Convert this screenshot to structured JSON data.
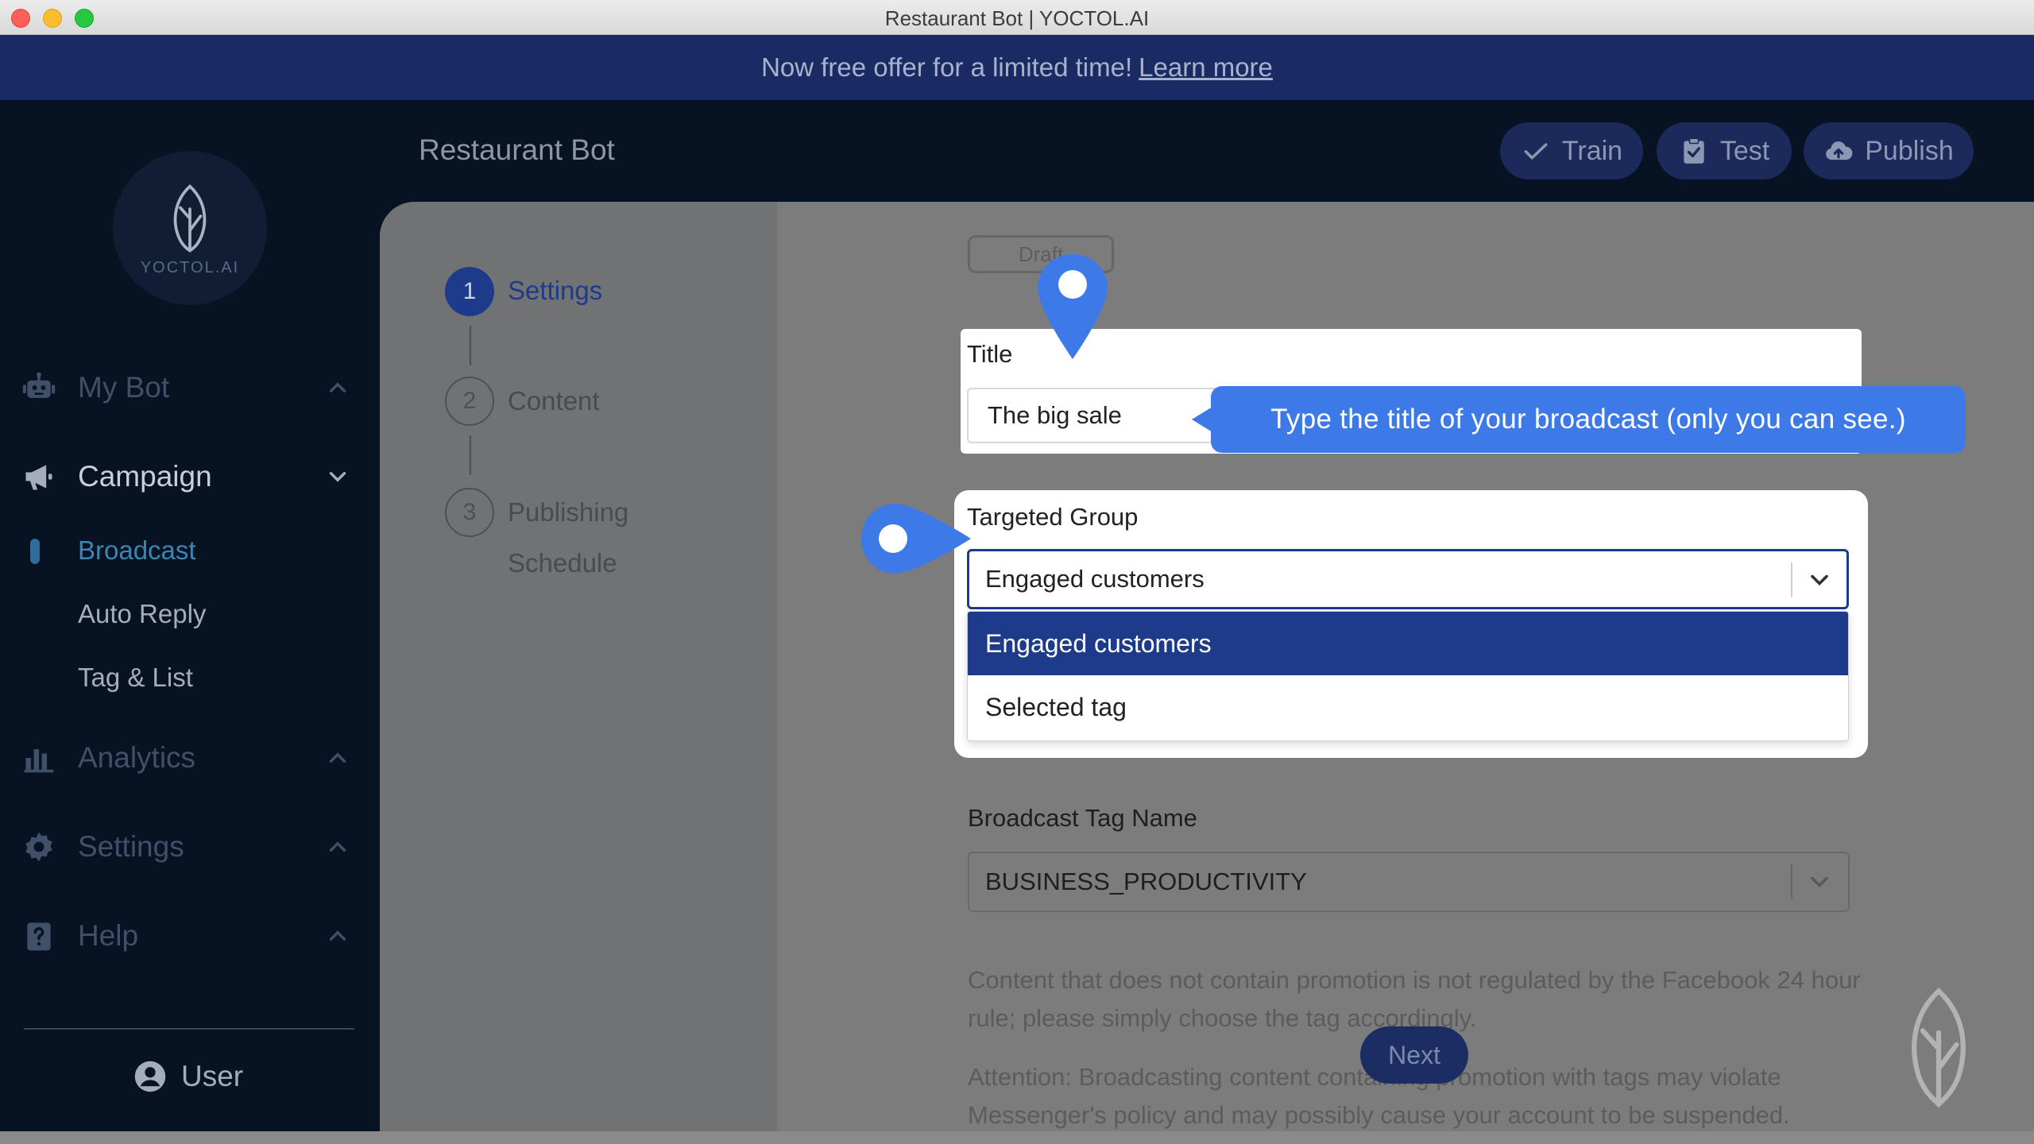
{
  "window": {
    "title": "Restaurant Bot | YOCTOL.AI"
  },
  "banner": {
    "text": "Now free offer for a limited time!",
    "link": "Learn more"
  },
  "header": {
    "bot_name": "Restaurant Bot",
    "buttons": {
      "train": "Train",
      "test": "Test",
      "publish": "Publish"
    }
  },
  "sidebar": {
    "logo_text": "YOCTOL.AI",
    "my_bot": "My Bot",
    "campaign": "Campaign",
    "campaign_items": [
      "Broadcast",
      "Auto Reply",
      "Tag & List"
    ],
    "analytics": "Analytics",
    "settings": "Settings",
    "help": "Help",
    "user": "User"
  },
  "steps": [
    {
      "number": "1",
      "label": "Settings"
    },
    {
      "number": "2",
      "label": "Content"
    },
    {
      "number": "3",
      "label_line1": "Publishing",
      "label_line2": "Schedule"
    }
  ],
  "form": {
    "status_badge": "Draft",
    "title_label": "Title",
    "title_value": "The big sale",
    "tooltip": "Type the title of your broadcast (only you can see.)",
    "targeted_group_label": "Targeted Group",
    "targeted_group_value": "Engaged customers",
    "targeted_group_options": [
      "Engaged customers",
      "Selected tag"
    ],
    "broadcast_tag_label": "Broadcast Tag Name",
    "broadcast_tag_value": "BUSINESS_PRODUCTIVITY",
    "note1": "Content that does not contain promotion is not regulated by the Facebook 24 hour rule; please simply choose the tag accordingly.",
    "note2": "Attention: Broadcasting content containing promotion with tags may violate Messenger's policy and may possibly cause your account to be suspended.",
    "next_button": "Next"
  },
  "colors": {
    "accent": "#1e3a8a",
    "tooltip": "#3d7ae8",
    "banner": "#1a2b63",
    "sidebar_bg": "#071223"
  }
}
